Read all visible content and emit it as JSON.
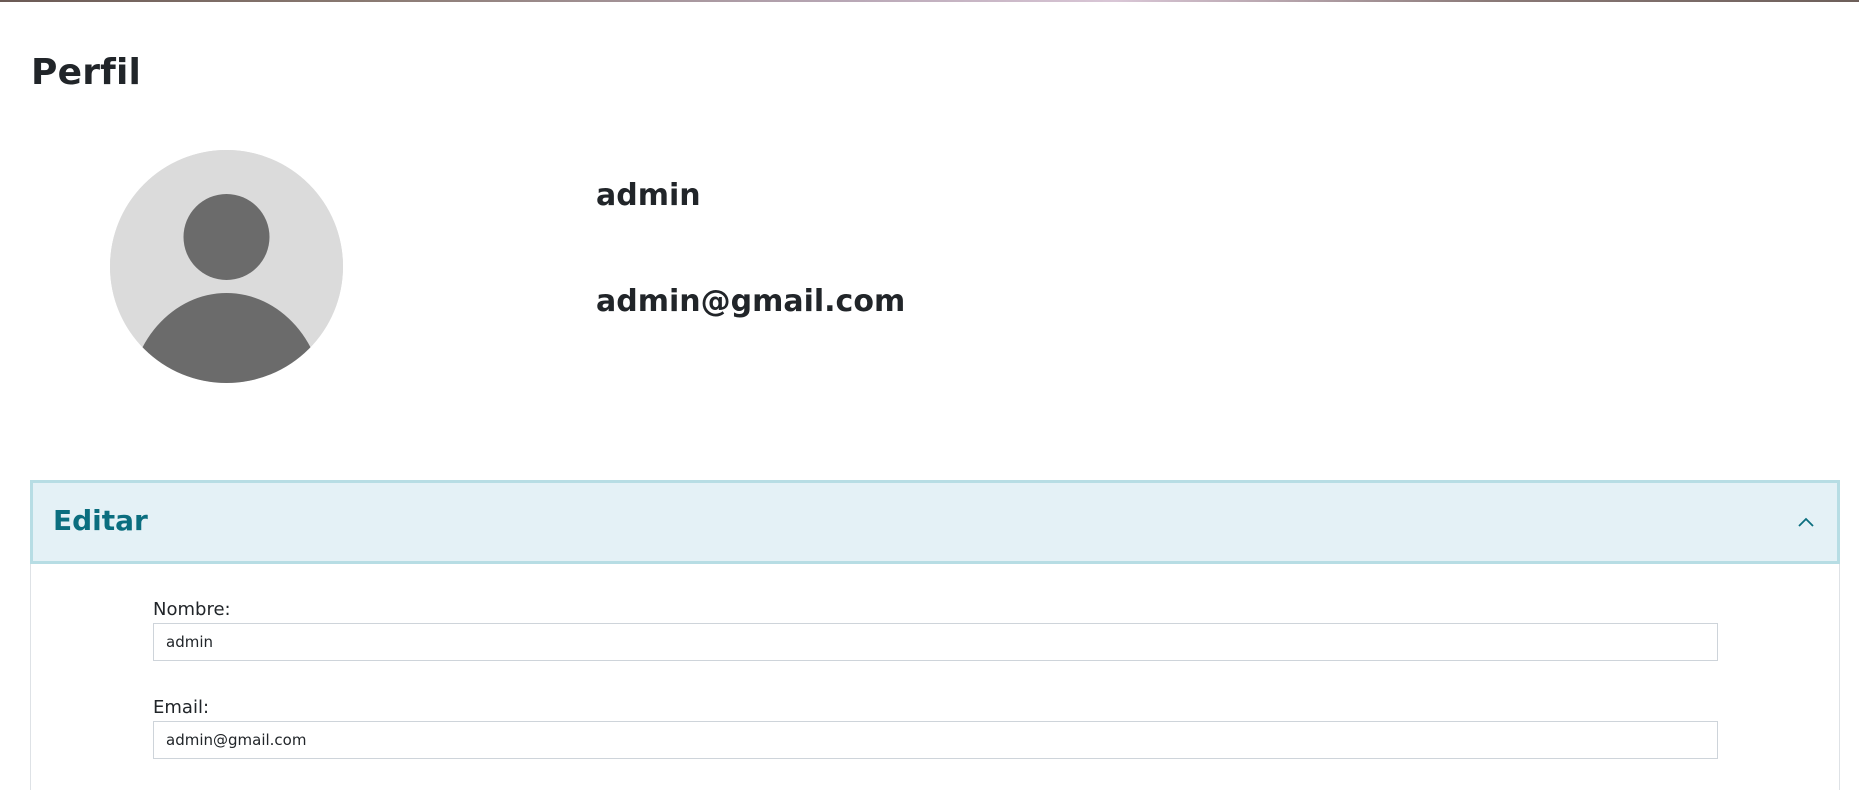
{
  "page": {
    "title": "Perfil"
  },
  "profile": {
    "name": "admin",
    "email": "admin@gmail.com",
    "avatar_icon": "user-placeholder-icon"
  },
  "edit_section": {
    "title": "Editar",
    "expanded": true,
    "toggle_icon": "chevron-up-icon",
    "fields": {
      "nombre": {
        "label": "Nombre:",
        "value": "admin"
      },
      "email": {
        "label": "Email:",
        "value": "admin@gmail.com"
      }
    }
  },
  "colors": {
    "accent": "#0b6e7f",
    "header_bg": "#e4f1f6",
    "header_border": "#b7dde4",
    "avatar_bg": "#dbdbdb",
    "avatar_fg": "#6b6b6b"
  }
}
